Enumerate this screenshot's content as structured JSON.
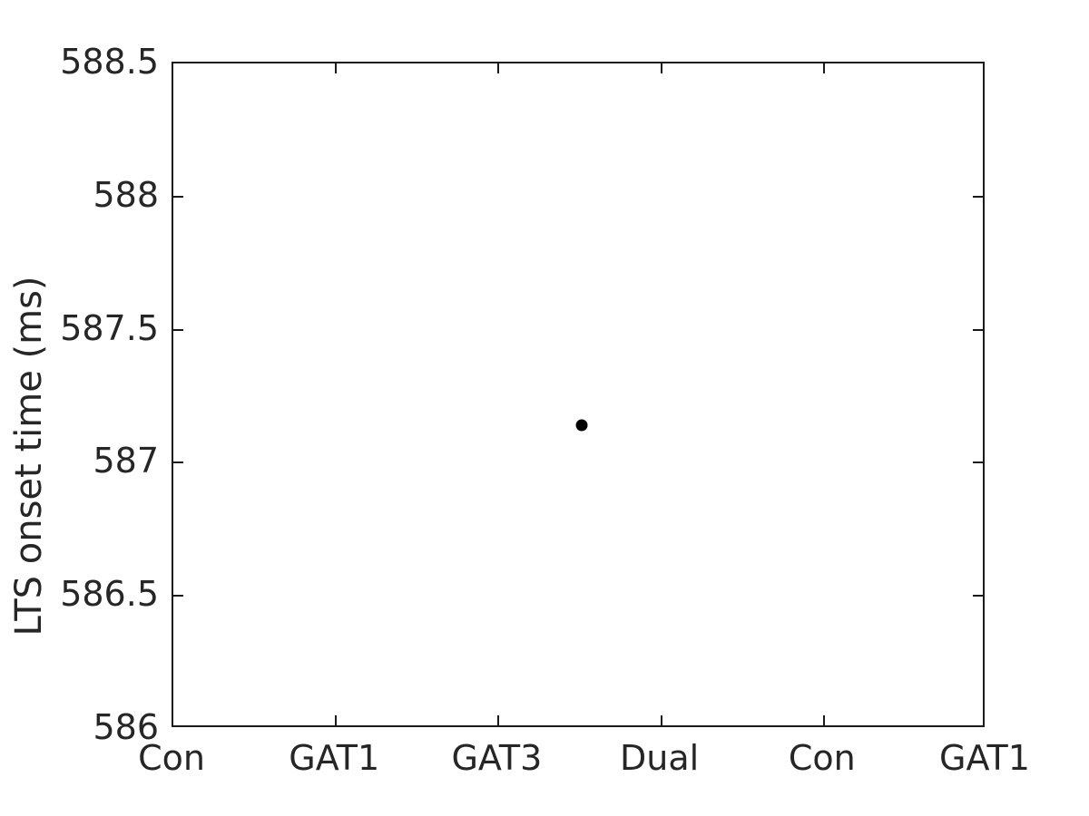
{
  "figure": {
    "background_color": "#ffffff",
    "axis_color": "#1a1a1a",
    "marker_color": "#000000"
  },
  "chart_data": {
    "type": "scatter",
    "title": "",
    "xlabel": "",
    "ylabel": "LTS onset time (ms)",
    "categories": [
      "Con",
      "GAT1",
      "GAT3",
      "Dual",
      "Con",
      "GAT1"
    ],
    "xticks": [
      1,
      2,
      3,
      4,
      5,
      6
    ],
    "xticklabels": [
      "Con",
      "GAT1",
      "GAT3",
      "Dual",
      "Con",
      "GAT1"
    ],
    "xlim": [
      1,
      6
    ],
    "ylim": [
      586,
      588.5
    ],
    "yticks": [
      586,
      586.5,
      587,
      587.5,
      588,
      588.5
    ],
    "yticklabels": [
      "586",
      "586.5",
      "587",
      "587.5",
      "588",
      "588.5"
    ],
    "grid": false,
    "legend": null,
    "series": [
      {
        "name": "LTS onset time",
        "marker": "circle",
        "color": "#000000",
        "points": [
          {
            "x": 3.51,
            "y": 587.14,
            "category": "between GAT3 and Dual"
          }
        ]
      }
    ]
  },
  "axis_labels": {
    "y_title": "LTS onset time (ms)",
    "y_ticks": [
      {
        "value": 588.5,
        "label": "588.5"
      },
      {
        "value": 588,
        "label": "588"
      },
      {
        "value": 587.5,
        "label": "587.5"
      },
      {
        "value": 587,
        "label": "587"
      },
      {
        "value": 586.5,
        "label": "586.5"
      },
      {
        "value": 586,
        "label": "586"
      }
    ],
    "x_ticks": [
      {
        "value": 1,
        "label": "Con"
      },
      {
        "value": 2,
        "label": "GAT1"
      },
      {
        "value": 3,
        "label": "GAT3"
      },
      {
        "value": 4,
        "label": "Dual"
      },
      {
        "value": 5,
        "label": "Con"
      },
      {
        "value": 6,
        "label": "GAT1"
      }
    ]
  }
}
